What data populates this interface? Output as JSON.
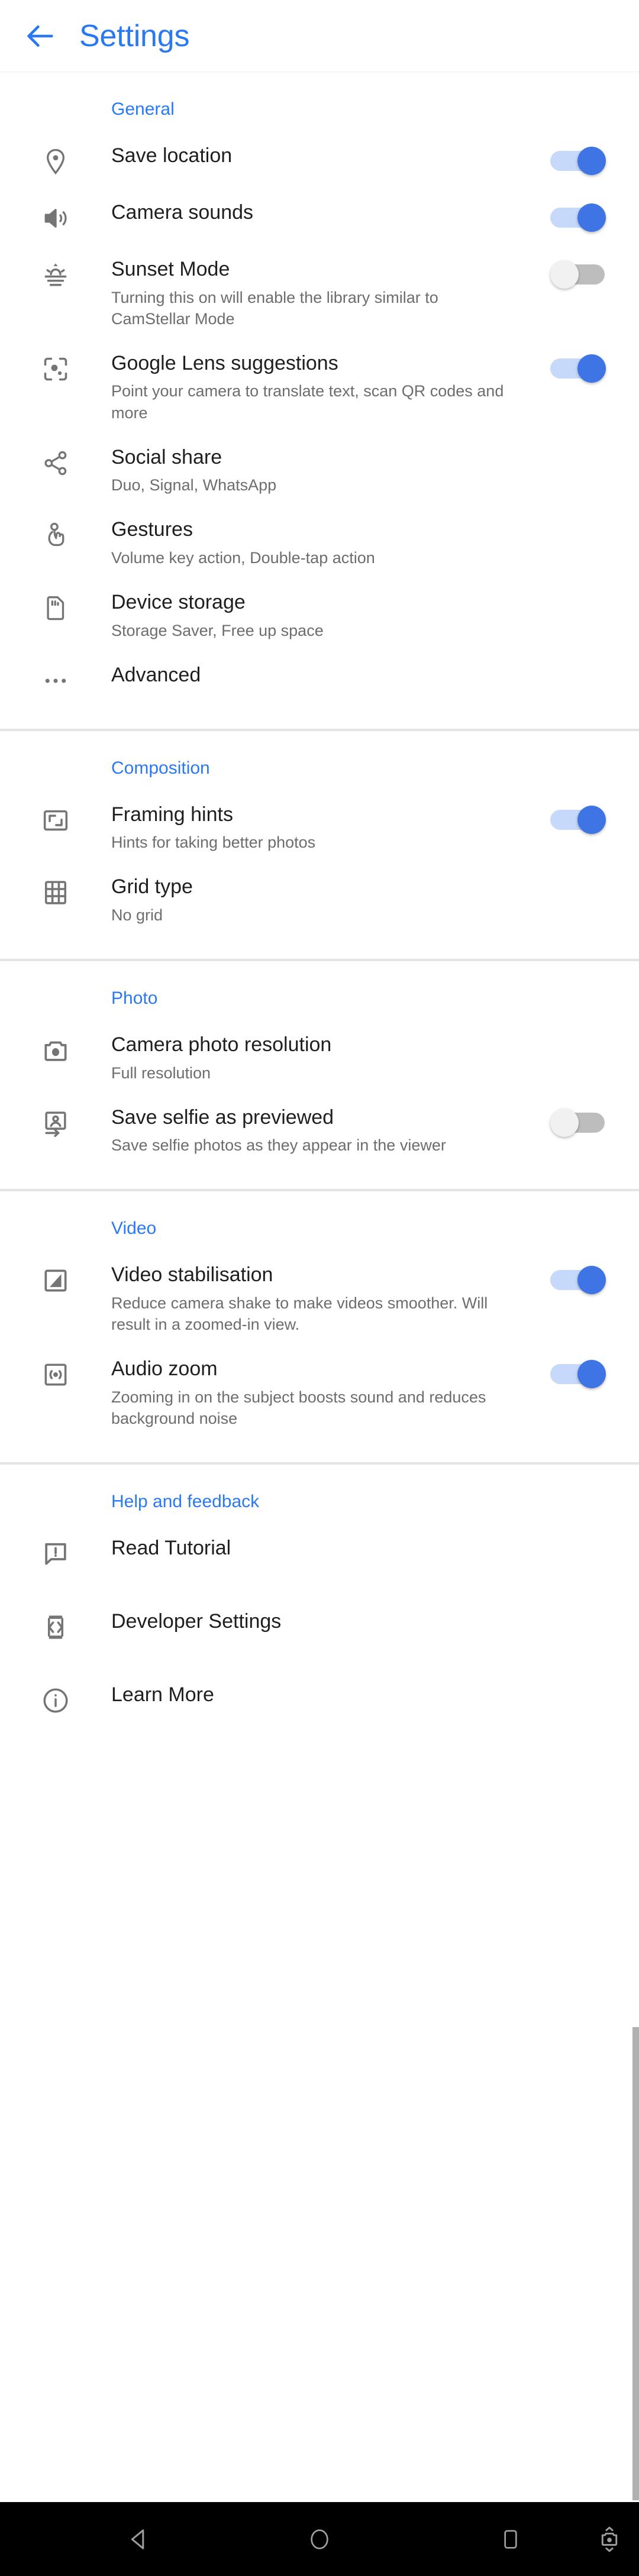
{
  "app": {
    "title": "Settings",
    "accent_color": "#2979f2",
    "title_color": "#2979f2",
    "back_icon": "arrow-back-icon"
  },
  "sections": [
    {
      "id": "general",
      "title": "General",
      "rows": [
        {
          "id": "save-location",
          "icon": "location-pin-icon",
          "title": "Save location",
          "subtitle": "",
          "control": "toggle",
          "toggle_state": "on"
        },
        {
          "id": "camera-sounds",
          "icon": "volume-up-icon",
          "title": "Camera sounds",
          "subtitle": "",
          "control": "toggle",
          "toggle_state": "on"
        },
        {
          "id": "sunset-mode",
          "icon": "sunset-icon",
          "title": "Sunset Mode",
          "subtitle": "Turning this on will enable the library similar to CamStellar Mode",
          "control": "toggle",
          "toggle_state": "off"
        },
        {
          "id": "google-lens",
          "icon": "lens-scan-icon",
          "title": "Google Lens suggestions",
          "subtitle": "Point your camera to translate text, scan QR codes and more",
          "control": "toggle",
          "toggle_state": "on"
        },
        {
          "id": "social-share",
          "icon": "share-icon",
          "title": "Social share",
          "subtitle": "Duo, Signal, WhatsApp",
          "control": "none",
          "toggle_state": ""
        },
        {
          "id": "gestures",
          "icon": "gesture-tap-icon",
          "title": "Gestures",
          "subtitle": "Volume key action, Double-tap action",
          "control": "none",
          "toggle_state": ""
        },
        {
          "id": "device-storage",
          "icon": "sd-card-icon",
          "title": "Device storage",
          "subtitle": "Storage Saver, Free up space",
          "control": "none",
          "toggle_state": ""
        },
        {
          "id": "advanced",
          "icon": "more-horiz-icon",
          "title": "Advanced",
          "subtitle": "",
          "control": "none",
          "toggle_state": ""
        }
      ]
    },
    {
      "id": "composition",
      "title": "Composition",
      "rows": [
        {
          "id": "framing-hints",
          "icon": "crop-frame-icon",
          "title": "Framing hints",
          "subtitle": "Hints for taking better photos",
          "control": "toggle",
          "toggle_state": "on"
        },
        {
          "id": "grid-type",
          "icon": "grid-icon",
          "title": "Grid type",
          "subtitle": "No grid",
          "control": "none",
          "toggle_state": ""
        }
      ]
    },
    {
      "id": "photo",
      "title": "Photo",
      "rows": [
        {
          "id": "camera-photo-resolution",
          "icon": "camera-icon",
          "title": "Camera photo resolution",
          "subtitle": "Full resolution",
          "control": "none",
          "toggle_state": ""
        },
        {
          "id": "save-selfie-previewed",
          "icon": "selfie-flip-icon",
          "title": "Save selfie as previewed",
          "subtitle": "Save selfie photos as they appear in the viewer",
          "control": "toggle",
          "toggle_state": "off"
        }
      ]
    },
    {
      "id": "video",
      "title": "Video",
      "rows": [
        {
          "id": "video-stabilisation",
          "icon": "stabilisation-icon",
          "title": "Video stabilisation",
          "subtitle": "Reduce camera shake to make videos smoother. Will result in a zoomed-in view.",
          "control": "toggle",
          "toggle_state": "on"
        },
        {
          "id": "audio-zoom",
          "icon": "audio-zoom-icon",
          "title": "Audio zoom",
          "subtitle": "Zooming in on the subject boosts sound and reduces background noise",
          "control": "toggle",
          "toggle_state": "on"
        }
      ]
    },
    {
      "id": "help-and-feedback",
      "title": "Help and feedback",
      "rows": [
        {
          "id": "read-tutorial",
          "icon": "feedback-icon",
          "title": "Read Tutorial",
          "subtitle": "",
          "control": "none",
          "toggle_state": ""
        },
        {
          "id": "developer-settings",
          "icon": "developer-icon",
          "title": "Developer Settings",
          "subtitle": "",
          "control": "none",
          "toggle_state": ""
        },
        {
          "id": "learn-more",
          "icon": "info-icon",
          "title": "Learn More",
          "subtitle": "",
          "control": "none",
          "toggle_state": ""
        }
      ]
    }
  ],
  "navbar": {
    "back": "nav-back-triangle-icon",
    "home": "nav-home-circle-icon",
    "recents": "nav-recents-square-icon",
    "rotate": "nav-rotate-screenshot-icon"
  }
}
